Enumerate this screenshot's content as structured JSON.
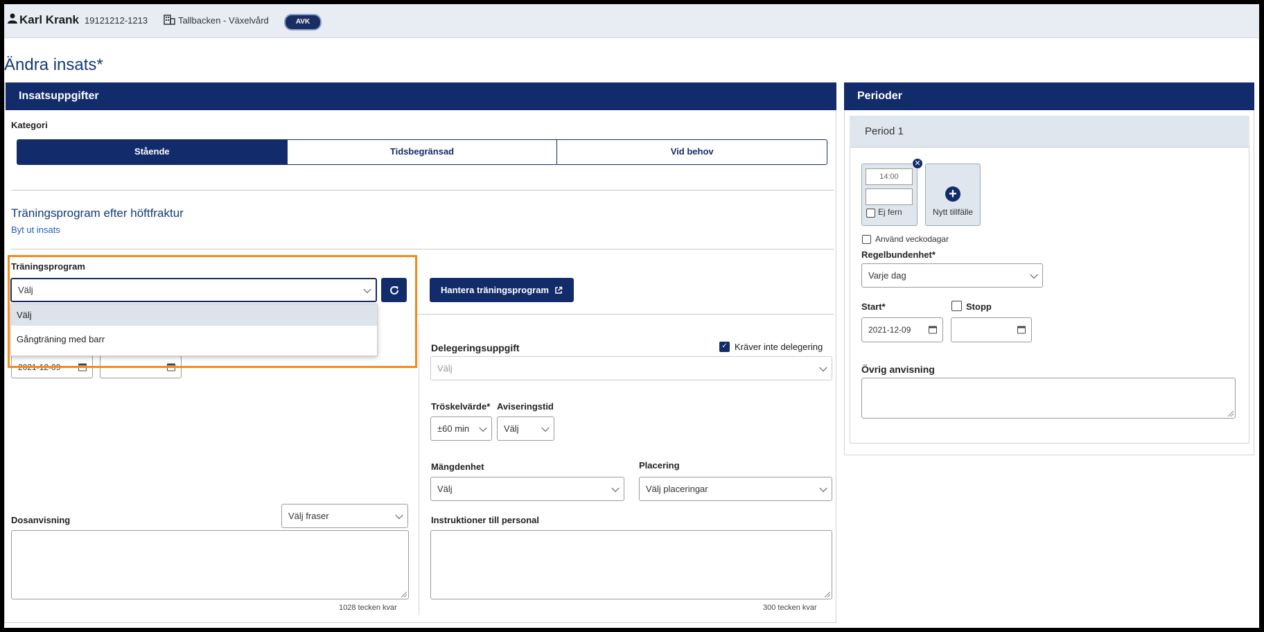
{
  "header": {
    "patient_name": "Karl Krank",
    "patient_id": "19121212-1213",
    "unit": "Tallbacken - Växelvård",
    "badge": "AVK"
  },
  "page_title": "Ändra insats*",
  "insats": {
    "panel_title": "Insatsuppgifter",
    "kategori_label": "Kategori",
    "kategori_options": [
      "Stående",
      "Tidsbegränsad",
      "Vid behov"
    ],
    "kategori_selected": "Stående",
    "insats_name": "Träningsprogram efter höftfraktur",
    "replace_link": "Byt ut insats",
    "program_label": "Träningsprogram",
    "program_value": "Välj",
    "program_options": [
      "Välj",
      "Gångträning med barr"
    ],
    "manage_button": "Hantera träningsprogram",
    "start_date": "2021-12-09",
    "stop_date": "",
    "delegering_label": "Delegeringsuppgift",
    "delegering_value": "Välj",
    "no_delegation_label": "Kräver inte delegering",
    "threshold_label": "Tröskelvärde*",
    "threshold_value": "±60 min",
    "notify_label": "Aviseringstid",
    "notify_value": "Välj",
    "amount_label": "Mängdenhet",
    "amount_value": "Välj",
    "placement_label": "Placering",
    "placement_value": "Välj placeringar",
    "dose_label": "Dosanvisning",
    "dose_phrase_value": "Välj fraser",
    "dose_counter": "1028 tecken kvar",
    "staff_label": "Instruktioner till personal",
    "staff_counter": "300 tecken kvar"
  },
  "perioder": {
    "panel_title": "Perioder",
    "period_title": "Period 1",
    "time_value": "14:00",
    "ej_fern_label": "Ej fern",
    "new_occasion_label": "Nytt tillfälle",
    "weekdays_label": "Använd veckodagar",
    "regularity_label": "Regelbundenhet*",
    "regularity_value": "Varje dag",
    "start_label": "Start*",
    "start_value": "2021-12-09",
    "stop_label": "Stopp",
    "stop_value": "",
    "other_label": "Övrig anvisning"
  },
  "colors": {
    "primary": "#122b6a",
    "highlight": "#f28a1e",
    "topbar": "#e7edf3"
  }
}
